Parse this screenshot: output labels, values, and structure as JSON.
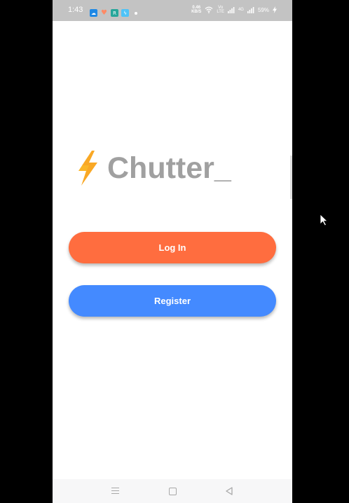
{
  "status_bar": {
    "time": "1:43",
    "notification_icons": [
      "cloud-icon",
      "heart-icon",
      "app-r-icon",
      "bolt-app-icon"
    ],
    "net_speed_value": "0.46",
    "net_speed_unit": "KB/S",
    "lte_label_top": "Vo",
    "lte_label_bottom": "LTE",
    "signal_label": "4G",
    "battery_percent": "59%"
  },
  "logo": {
    "icon": "lightning-bolt-icon",
    "text": "Chutter_",
    "bolt_color": "#f9a825",
    "text_color": "#a0a0a0"
  },
  "buttons": {
    "login_label": "Log In",
    "login_color": "#ff6d3f",
    "register_label": "Register",
    "register_color": "#448aff"
  },
  "nav_bar": {
    "icons": [
      "menu-icon",
      "home-square-icon",
      "back-triangle-icon"
    ]
  }
}
